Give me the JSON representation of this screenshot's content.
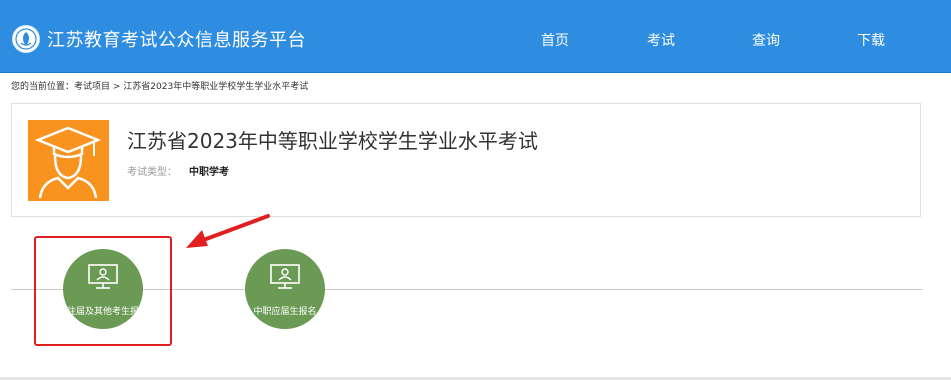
{
  "header": {
    "site_title": "江苏教育考试公众信息服务平台",
    "nav": [
      "首页",
      "考试",
      "查询",
      "下载"
    ]
  },
  "breadcrumb": {
    "prefix": "您的当前位置：",
    "items": [
      "考试项目",
      "江苏省2023年中等职业学校学生学业水平考试"
    ],
    "separator": " > "
  },
  "exam": {
    "title": "江苏省2023年中等职业学校学生学业水平考试",
    "type_label": "考试类型：",
    "type_value": "中职学考"
  },
  "actions": [
    {
      "label": "往届及其他考生报"
    },
    {
      "label": "中职应届生报名"
    }
  ],
  "colors": {
    "header": "#2e8de0",
    "exam_icon_bg": "#f7931e",
    "action_circle": "#6b9a54",
    "annotation": "#e02020"
  }
}
